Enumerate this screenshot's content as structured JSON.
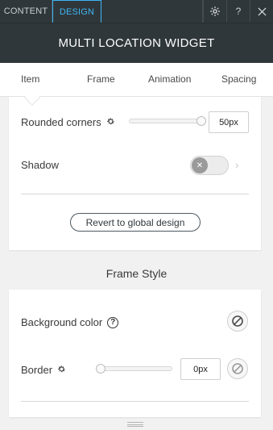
{
  "topbar": {
    "tabs": [
      {
        "label": "CONTENT",
        "active": false
      },
      {
        "label": "DESIGN",
        "active": true
      }
    ],
    "icons": [
      "gear-icon",
      "help-icon",
      "close-icon"
    ],
    "help_glyph": "?"
  },
  "title": "MULTI LOCATION WIDGET",
  "subtabs": [
    "Item",
    "Frame",
    "Animation",
    "Spacing"
  ],
  "active_subtab": "Item",
  "item_design": {
    "rounded_corners": {
      "label": "Rounded corners",
      "value": "50px",
      "slider_fraction": 1.0
    },
    "shadow": {
      "label": "Shadow",
      "enabled": false
    },
    "revert_label": "Revert to global design"
  },
  "frame_style": {
    "title": "Frame Style",
    "background_color": {
      "label": "Background color",
      "help_glyph": "?"
    },
    "border": {
      "label": "Border",
      "value": "0px",
      "slider_fraction": 0.0
    }
  },
  "colors": {
    "header_bg": "#30373b",
    "accent": "#3eb6f2"
  }
}
